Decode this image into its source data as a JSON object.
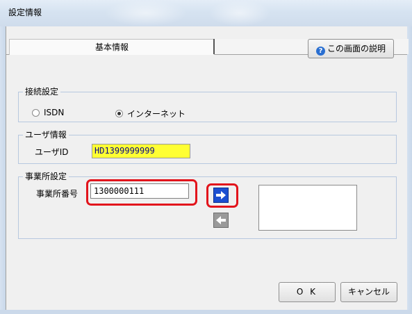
{
  "window": {
    "title": "設定情報"
  },
  "tabs": [
    {
      "label": "基本情報",
      "active": true
    }
  ],
  "help_button": {
    "label": "この画面の説明",
    "icon": "question-icon"
  },
  "connection": {
    "legend": "接続設定",
    "options": [
      {
        "label": "ISDN",
        "checked": false
      },
      {
        "label": "インターネット",
        "checked": true
      }
    ]
  },
  "user": {
    "legend": "ユーザ情報",
    "id_label": "ユーザID",
    "id_value": "HD1399999999"
  },
  "office": {
    "legend": "事業所設定",
    "number_label": "事業所番号",
    "number_value": "1300000111"
  },
  "footer": {
    "ok_label": "O K",
    "cancel_label": "キャンセル"
  },
  "colors": {
    "highlight": "#e2141c",
    "user_id_bg": "#ffff33",
    "arrow_active": "#1c4fd1"
  }
}
